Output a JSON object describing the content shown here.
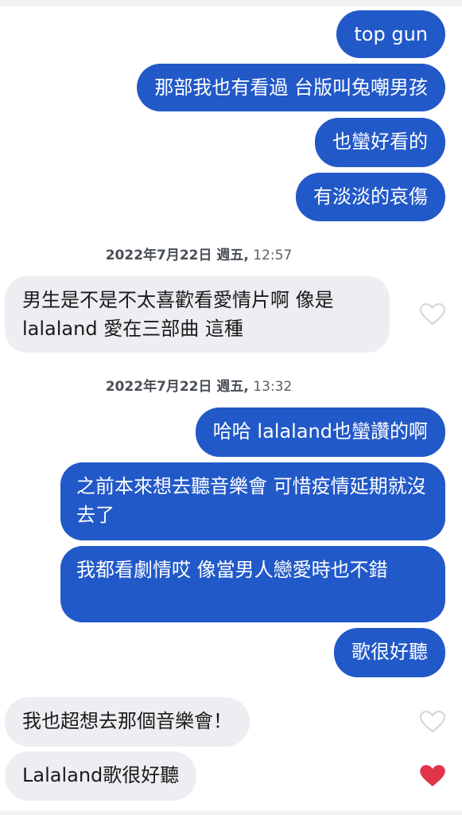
{
  "colors": {
    "sent_bubble": "#2259c8",
    "received_bubble": "#eceef1",
    "heart_liked": "#e0344b",
    "heart_outline": "#d6d8dc"
  },
  "messages": [
    {
      "text": "top gun"
    },
    {
      "text": "那部我也有看過 台版叫兔嘲男孩"
    },
    {
      "text": "也蠻好看的"
    },
    {
      "text": "有淡淡的哀傷"
    },
    {
      "text": "男生是不是不太喜歡看愛情片啊 像是lalaland 愛在三部曲 這種"
    },
    {
      "text": "哈哈 lalaland也蠻讚的啊"
    },
    {
      "text": "之前本來想去聽音樂會 可惜疫情延期就沒去了"
    },
    {
      "text": "我都看劇情哎 像當男人戀愛時也不錯"
    },
    {
      "text": "歌很好聽"
    },
    {
      "text": "我也超想去那個音樂會！"
    },
    {
      "text": "Lalaland歌很好聽"
    }
  ],
  "timestamps": [
    {
      "date": "2022年7月22日 週五,",
      "time": "12:57"
    },
    {
      "date": "2022年7月22日 週五,",
      "time": "13:32"
    }
  ],
  "icons": {
    "heart_outline": "heart-outline-icon",
    "heart_filled": "heart-filled-icon"
  }
}
